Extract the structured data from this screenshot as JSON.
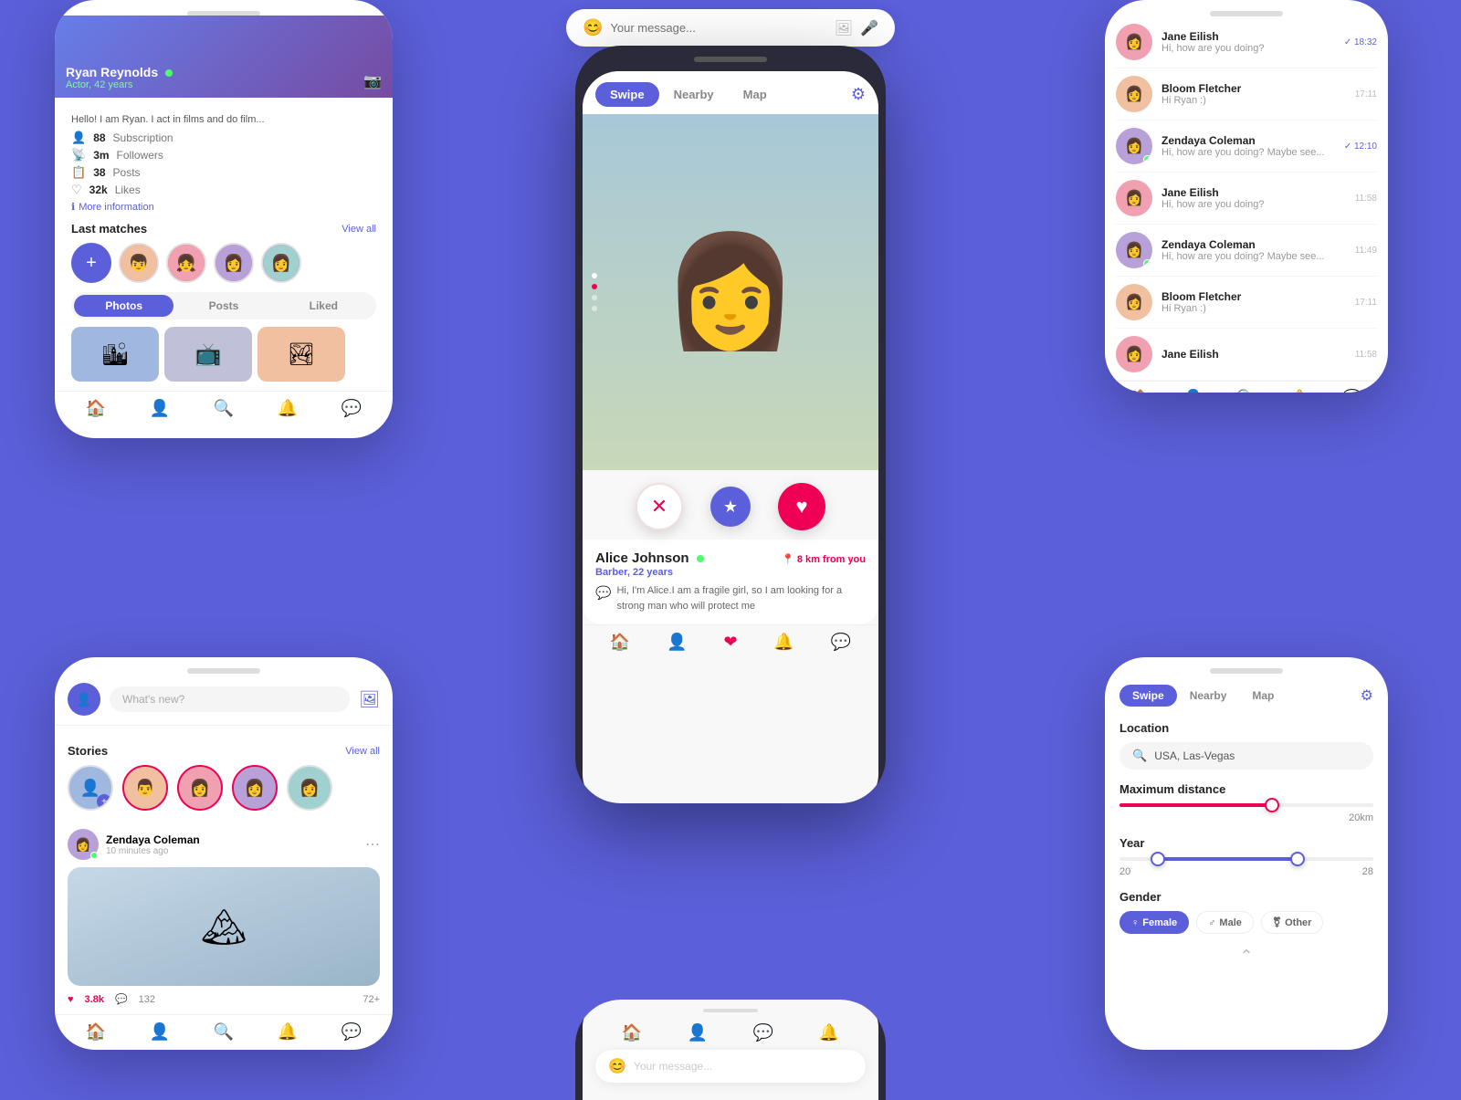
{
  "phone1": {
    "header": {
      "name": "Ryan Reynolds",
      "online_indicator": "●",
      "subtitle": "Actor, 42 years"
    },
    "bio": "Hello! I am Ryan. I act in films and do film...",
    "stats": [
      {
        "icon": "👤",
        "num": "88",
        "label": "Subscription"
      },
      {
        "icon": "📡",
        "num": "3m",
        "label": "Followers"
      },
      {
        "icon": "📋",
        "num": "38",
        "label": "Posts"
      },
      {
        "icon": "♡",
        "num": "32k",
        "label": "Likes"
      }
    ],
    "more_info": "More information",
    "last_matches_title": "Last matches",
    "view_all": "View all",
    "tabs": [
      "Photos",
      "Posts",
      "Liked"
    ],
    "active_tab": "Photos"
  },
  "phone2": {
    "chats": [
      {
        "name": "Jane Eilish",
        "msg": "Hi, how are you doing?",
        "time": "18:32",
        "read": true,
        "online": false
      },
      {
        "name": "Bloom Fletcher",
        "msg": "Hi Ryan :)",
        "time": "17:11",
        "read": false,
        "online": false
      },
      {
        "name": "Zendaya Coleman",
        "msg": "Hi, how are you doing? Maybe see...",
        "time": "12:10",
        "read": true,
        "online": true
      },
      {
        "name": "Jane Eilish",
        "msg": "Hi, how are you doing?",
        "time": "11:58",
        "read": false,
        "online": false
      },
      {
        "name": "Zendaya Coleman",
        "msg": "Hi, how are you doing? Maybe see...",
        "time": "11:49",
        "read": false,
        "online": true
      },
      {
        "name": "Bloom Fletcher",
        "msg": "Hi Ryan :)",
        "time": "17:11",
        "read": false,
        "online": false
      },
      {
        "name": "Jane Eilish",
        "msg": "",
        "time": "11:58",
        "read": false,
        "online": false
      }
    ],
    "nav": [
      "🏠",
      "👤",
      "🔍",
      "🔔",
      "💬"
    ]
  },
  "phoneCenter": {
    "tabs": [
      "Swipe",
      "Nearby",
      "Map"
    ],
    "active_tab": "Swipe",
    "profile": {
      "name": "Alice Johnson",
      "online": true,
      "distance": "8 km from you",
      "subtitle": "Barber, 22 years",
      "bio": "Hi, I'm Alice.I am a fragile girl, so I am looking for a strong man who will protect me"
    },
    "actions": {
      "close": "✕",
      "star": "★",
      "love": "♥"
    }
  },
  "phone3": {
    "feed_placeholder": "What's new?",
    "stories_title": "Stories",
    "view_all": "View all",
    "post": {
      "name": "Zendaya Coleman",
      "time": "10 minutes ago",
      "likes": "3.8k",
      "comments": "132",
      "views": "72+"
    }
  },
  "phone4": {
    "tabs": [
      "Swipe",
      "Nearby",
      "Map"
    ],
    "active_tab": "Swipe",
    "location_label": "Location",
    "location_value": "USA, Las-Vegas",
    "max_distance_label": "Maximum distance",
    "max_distance_value": "20km",
    "year_label": "Year",
    "year_min": "20",
    "year_max": "28",
    "gender_label": "Gender",
    "genders": [
      "Female",
      "Male",
      "Other"
    ],
    "active_gender": "Female"
  },
  "msg_bar": {
    "placeholder": "Your message...",
    "send_icon": "📷",
    "mic_icon": "🎤",
    "emoji_icon": "😊"
  }
}
